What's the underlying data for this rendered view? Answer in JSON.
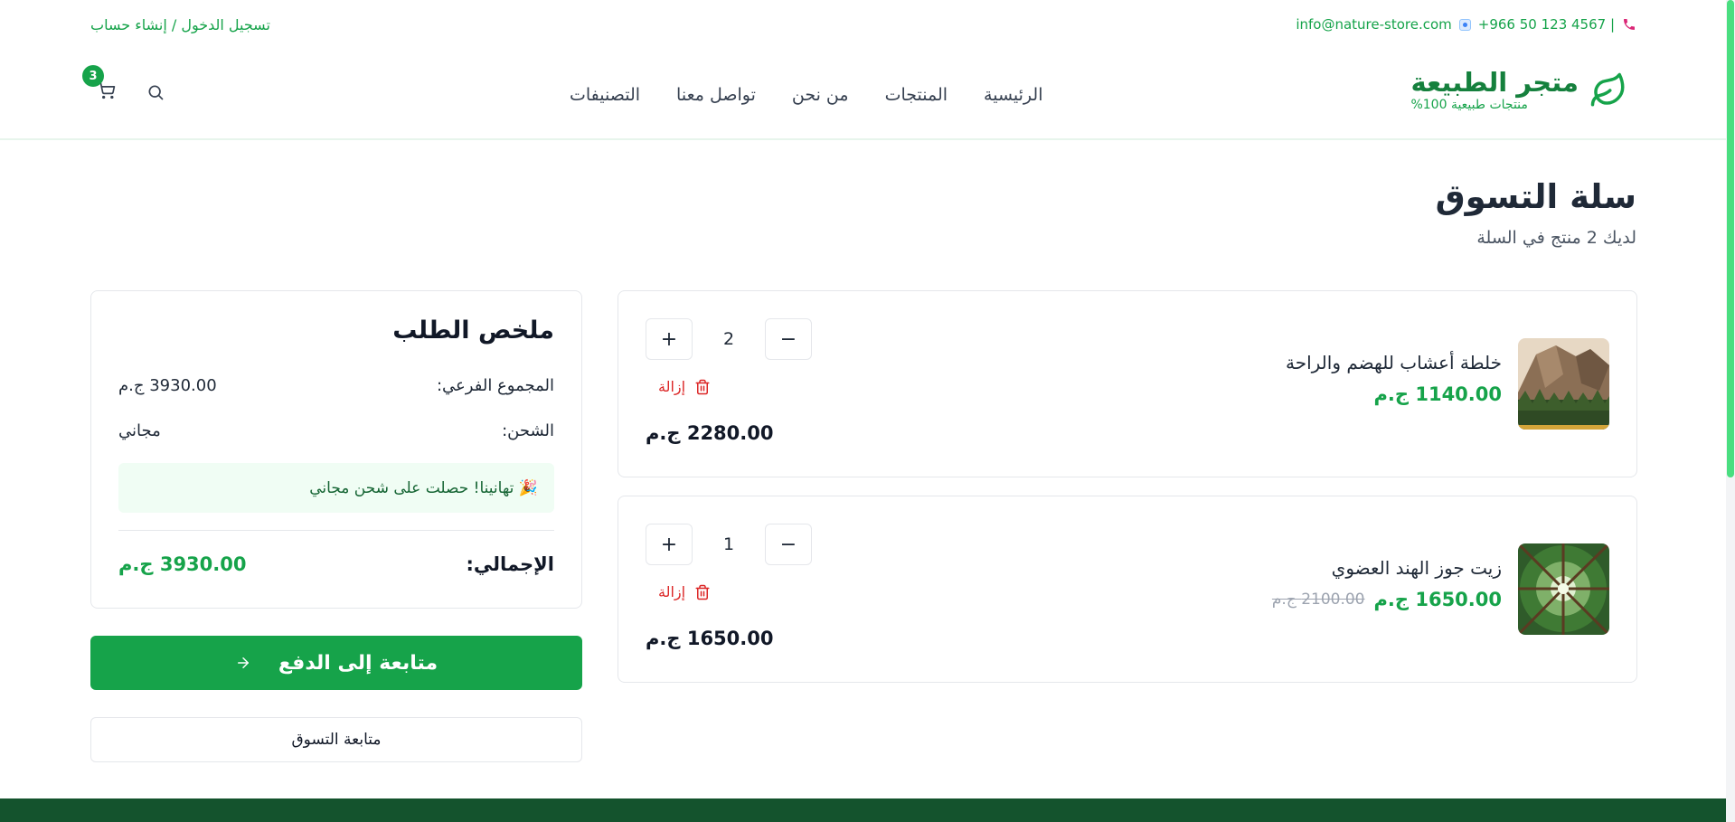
{
  "topbar": {
    "phone": "+966 50 123 4567 |",
    "email": "info@nature-store.com",
    "auth": "تسجيل الدخول / إنشاء حساب"
  },
  "header": {
    "logo_title": "متجر الطبيعة",
    "logo_sub": "منتجات طبيعية 100%",
    "nav": [
      "الرئيسية",
      "المنتجات",
      "من نحن",
      "تواصل معنا",
      "التصنيفات"
    ],
    "cart_count": "3",
    "icons": [
      "leaf-icon",
      "search-icon",
      "cart-icon",
      "phone-icon"
    ]
  },
  "page": {
    "title": "سلة التسوق",
    "subtitle": "لديك 2 منتج في السلة"
  },
  "items": [
    {
      "name": "خلطة أعشاب للهضم والراحة",
      "price": "1140.00 ج.م",
      "old_price": "",
      "quantity": "2",
      "remove": "إزالة",
      "line_total": "2280.00 ج.م"
    },
    {
      "name": "زيت جوز الهند العضوي",
      "price": "1650.00 ج.م",
      "old_price": "2100.00 ج.م",
      "quantity": "1",
      "remove": "إزالة",
      "line_total": "1650.00 ج.م"
    }
  ],
  "summary": {
    "title": "ملخص الطلب",
    "subtotal_label": "المجموع الفرعي:",
    "subtotal_value": "3930.00 ج.م",
    "shipping_label": "الشحن:",
    "shipping_value": "مجاني",
    "notice": "🎉 تهانينا! حصلت على شحن مجاني",
    "total_label": "الإجمالي:",
    "total_value": "3930.00 ج.م"
  },
  "actions": {
    "checkout": "متابعة إلى الدفع",
    "continue": "متابعة التسوق"
  },
  "colors": {
    "primary": "#16a34a",
    "danger": "#dc2626",
    "footer": "#14532d"
  }
}
